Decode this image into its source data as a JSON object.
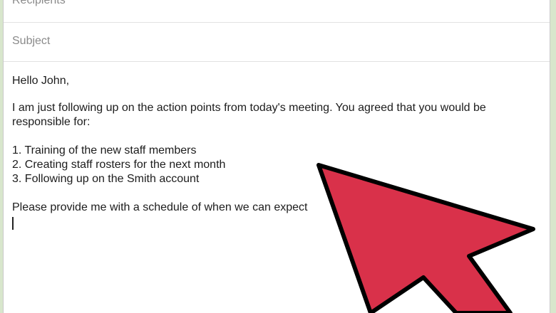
{
  "compose": {
    "recipients_placeholder": "Recipients",
    "subject_placeholder": "Subject",
    "greeting": "Hello John,",
    "paragraph_1_line_1": "I am just following up on the action points from today's meeting. You agreed that you would be",
    "paragraph_1_line_2": "responsible for:",
    "items": [
      "1. Training of the new staff members",
      "2. Creating staff rosters for the next month",
      "3. Following up on the Smith account"
    ],
    "closing_line": "Please provide me with a schedule of when we can expect"
  },
  "colors": {
    "arrow_fill": "#d9314a",
    "arrow_outline": "#000000",
    "background": "#d8e6cc"
  },
  "icons": {
    "arrow": "red-pointer-arrow-icon"
  }
}
